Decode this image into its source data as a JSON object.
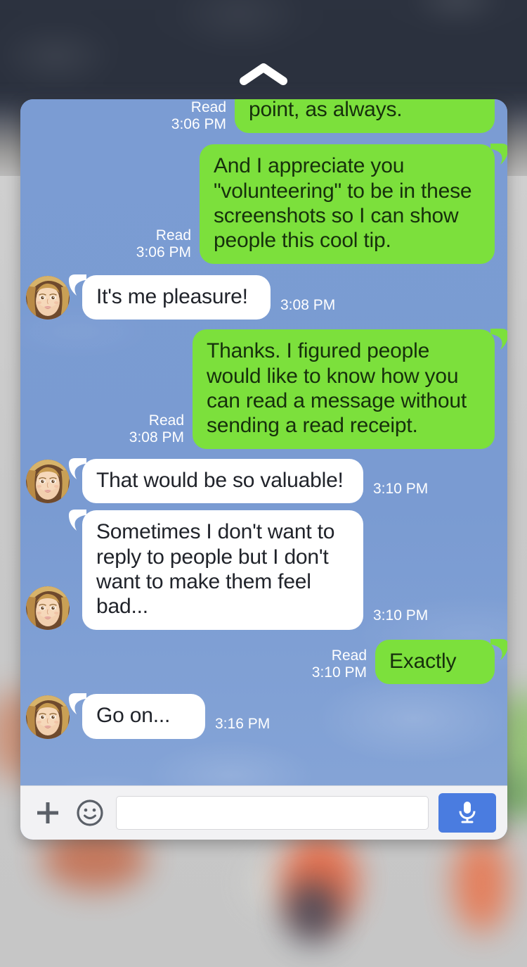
{
  "wallpaper": {
    "top_color": "#2c323f",
    "bottom_color": "#c9c9c9"
  },
  "handle": {
    "icon": "chevron-up-icon",
    "color": "#ffffff"
  },
  "chat": {
    "background_color": "#7a9bd2",
    "outgoing_bubble_color": "#7ce03c",
    "incoming_bubble_color": "#ffffff",
    "messages": [
      {
        "id": "m1",
        "direction": "out",
        "text": "point, as always.",
        "clipped": true,
        "status": "Read",
        "time": "3:06 PM"
      },
      {
        "id": "m2",
        "direction": "out",
        "text": "And I appreciate you \"volunteering\" to be in these screenshots so I can show people this cool tip.",
        "clipped": false,
        "status": "Read",
        "time": "3:06 PM"
      },
      {
        "id": "m3",
        "direction": "in",
        "text": "It's me pleasure!",
        "clipped": false,
        "status": "",
        "time": "3:08 PM"
      },
      {
        "id": "m4",
        "direction": "out",
        "text": "Thanks. I figured people would like to know how you can read a message without sending a read receipt.",
        "clipped": false,
        "status": "Read",
        "time": "3:08 PM"
      },
      {
        "id": "m5",
        "direction": "in",
        "text": "That would be so valuable!",
        "clipped": false,
        "status": "",
        "time": "3:10 PM"
      },
      {
        "id": "m6",
        "direction": "in",
        "text": "Sometimes I don't want to reply to people but I don't want to make them feel bad...",
        "clipped": false,
        "status": "",
        "time": "3:10 PM"
      },
      {
        "id": "m7",
        "direction": "out",
        "text": "Exactly",
        "clipped": false,
        "status": "Read",
        "time": "3:10 PM"
      },
      {
        "id": "m8",
        "direction": "in",
        "text": "Go on...",
        "clipped": false,
        "status": "",
        "time": "3:16 PM"
      }
    ]
  },
  "composer": {
    "attach_icon": "plus-icon",
    "emoji_icon": "smiley-icon",
    "input_value": "",
    "input_placeholder": "",
    "mic_icon": "microphone-icon",
    "mic_button_color": "#4a7ce0"
  }
}
